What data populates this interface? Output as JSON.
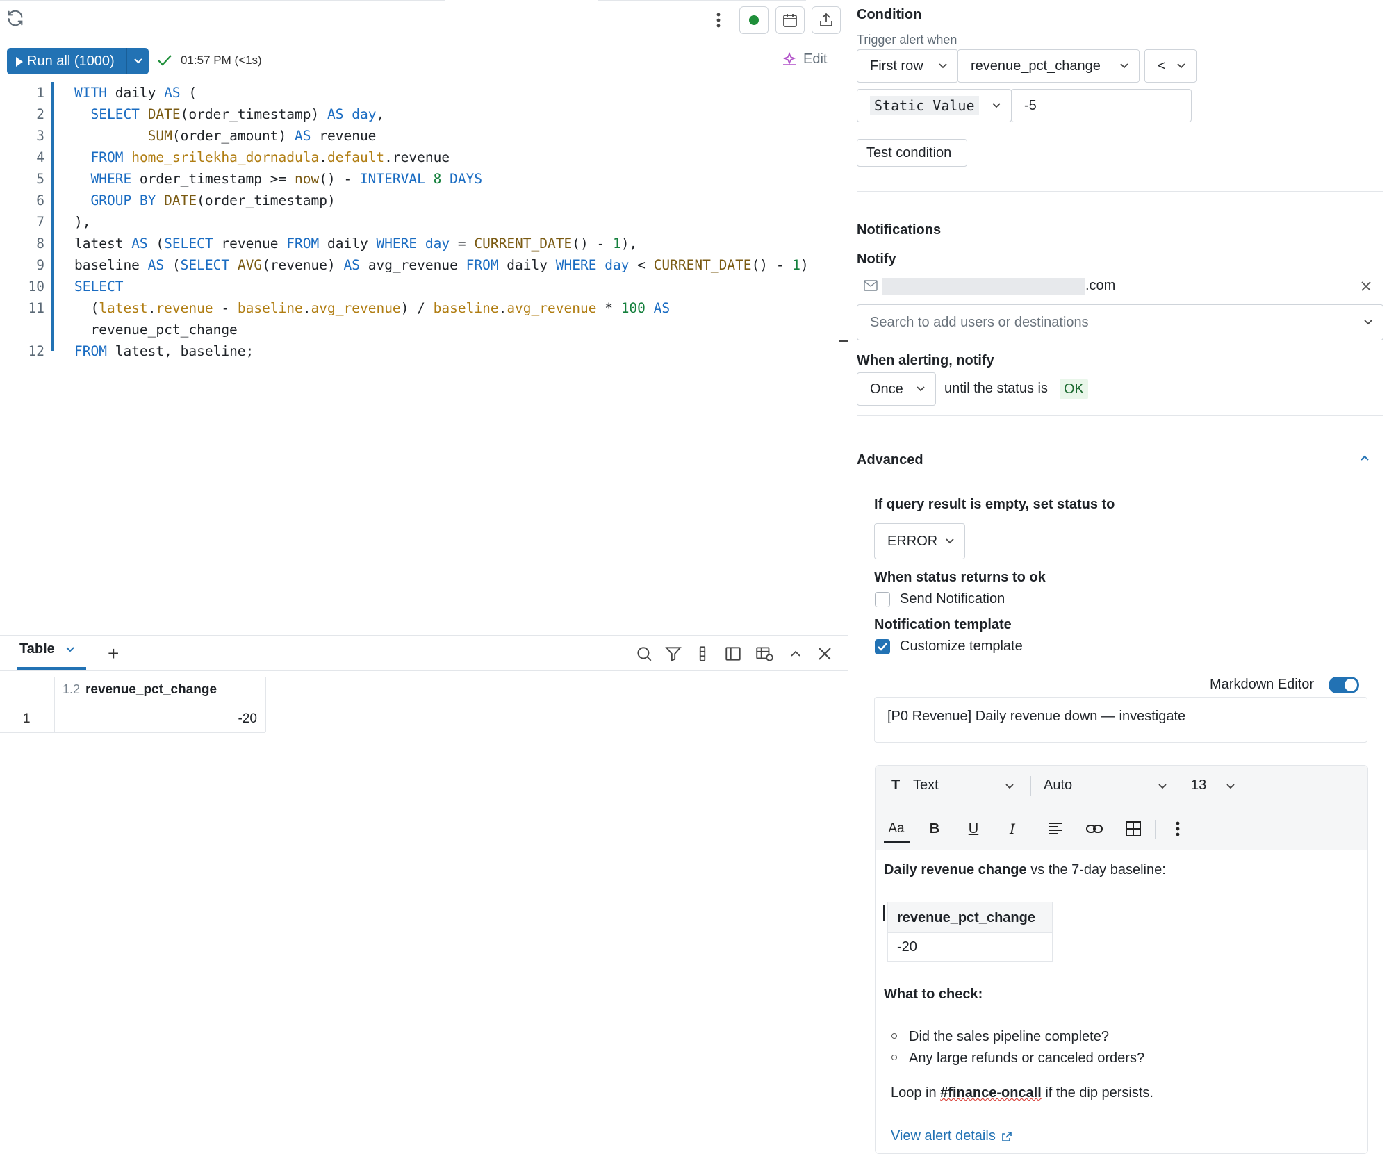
{
  "toolbar": {
    "run_label": "Run all (1000)",
    "run_status": "01:57 PM (<1s)",
    "edit_label": "Edit"
  },
  "editor": {
    "line_numbers": [
      "1",
      "2",
      "3",
      "4",
      "5",
      "6",
      "7",
      "8",
      "9",
      "10",
      "11",
      "",
      "12"
    ],
    "lines": [
      "WITH daily AS (",
      "  SELECT DATE(order_timestamp) AS day,",
      "         SUM(order_amount) AS revenue",
      "  FROM home_srilekha_dornadula.default.revenue",
      "  WHERE order_timestamp >= now() - INTERVAL 8 DAYS",
      "  GROUP BY DATE(order_timestamp)",
      "),",
      "latest AS (SELECT revenue FROM daily WHERE day = CURRENT_DATE() - 1),",
      "baseline AS (SELECT AVG(revenue) AS avg_revenue FROM daily WHERE day < CURRENT_DATE() - 1)",
      "SELECT",
      "  (latest.revenue - baseline.avg_revenue) / baseline.avg_revenue * 100 AS",
      "  revenue_pct_change",
      "FROM latest, baseline;"
    ]
  },
  "results": {
    "tab_label": "Table",
    "column_type": "1.2",
    "column_name": "revenue_pct_change",
    "rows": [
      {
        "index": "1",
        "value": "-20"
      }
    ]
  },
  "condition": {
    "title": "Condition",
    "trigger_label": "Trigger alert when",
    "row_select": "First row",
    "column_select": "revenue_pct_change",
    "operator_select": "<",
    "value_type_select": "Static Value",
    "value": "-5",
    "test_button": "Test condition"
  },
  "notifications": {
    "title": "Notifications",
    "notify_label": "Notify",
    "recipient_suffix": ".com",
    "search_placeholder": "Search to add users or destinations",
    "when_alerting_label": "When alerting, notify",
    "frequency_select": "Once",
    "until_text": "until the status is",
    "status_ok": "OK"
  },
  "advanced": {
    "title": "Advanced",
    "empty_result_label": "If query result is empty, set status to",
    "empty_status_select": "ERROR",
    "returns_ok_label": "When status returns to ok",
    "send_notification_label": "Send Notification",
    "template_label": "Notification template",
    "customize_template_label": "Customize template",
    "markdown_editor_label": "Markdown Editor",
    "subject": "[P0 Revenue] Daily revenue down — investigate"
  },
  "rich_editor": {
    "style_select": "Text",
    "font_select": "Auto",
    "size_select": "13",
    "intro_bold": "Daily revenue change",
    "intro_rest": " vs the 7-day baseline:",
    "table_header": "revenue_pct_change",
    "table_value": "-20",
    "check_heading": "What to check:",
    "bullets": [
      "Did the sales pipeline complete?",
      "Any large refunds or canceled orders?"
    ],
    "loop_prefix": "Loop in ",
    "loop_channel": "#finance-oncall",
    "loop_suffix": " if the dip persists.",
    "view_link": "View alert details"
  },
  "colors": {
    "accent": "#2272b4",
    "status_dot": "#1f8f3a"
  }
}
